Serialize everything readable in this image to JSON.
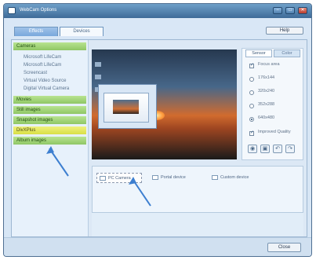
{
  "window": {
    "title": "WebCam Options"
  },
  "tabs": [
    {
      "label": "Effects"
    },
    {
      "label": "Devices"
    }
  ],
  "toolbar": {
    "help_label": "Help"
  },
  "sidebar": {
    "categories": [
      {
        "label": "Cameras"
      },
      {
        "label": "Movies"
      },
      {
        "label": "Still images"
      },
      {
        "label": "Snapshot images"
      },
      {
        "label": "DivXPlus"
      },
      {
        "label": "Album images"
      }
    ],
    "camera_items": [
      {
        "label": "Microsoft LifeCam"
      },
      {
        "label": "Microsoft LifeCam"
      },
      {
        "label": "Screencast"
      },
      {
        "label": "Virtual Video Source"
      },
      {
        "label": "Digital Virtual Camera"
      }
    ]
  },
  "right_panel": {
    "tabs": [
      {
        "label": "Sensor"
      },
      {
        "label": "Color"
      }
    ],
    "options": [
      {
        "label": "Focus area"
      },
      {
        "label": "176x144"
      },
      {
        "label": "320x240"
      },
      {
        "label": "352x288"
      },
      {
        "label": "640x480"
      },
      {
        "label": "Improved Quality"
      }
    ]
  },
  "devices": [
    {
      "label": "PC Camera"
    },
    {
      "label": "Portal device"
    },
    {
      "label": "Custom device"
    }
  ],
  "bottom": {
    "close_label": "Close"
  },
  "colors": {
    "sidebar_green": "#8fc765",
    "sidebar_yellow": "#d8df46",
    "accent_blue": "#3e6b98",
    "annotation_arrow": "#3d7fd0"
  }
}
